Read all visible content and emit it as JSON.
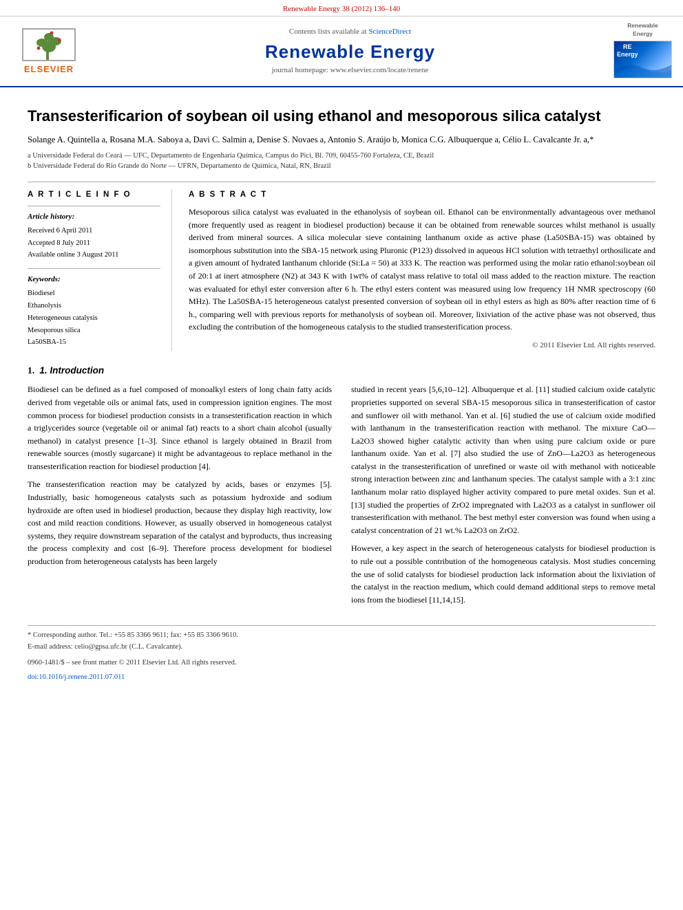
{
  "topbar": {
    "journal_ref": "Renewable Energy 38 (2012) 136–140"
  },
  "header": {
    "sciencedirect_text": "Contents lists available at",
    "sciencedirect_link": "ScienceDirect",
    "journal_name": "Renewable Energy",
    "homepage_text": "journal homepage: www.elsevier.com/locate/renene",
    "elsevier_label": "ELSEVIER",
    "re_label": "Renewable Energy"
  },
  "article": {
    "title": "Transesterificarion of soybean oil using ethanol and mesoporous silica catalyst",
    "authors": "Solange A. Quintella a, Rosana M.A. Saboya a, Davi C. Salmin a, Denise S. Novaes a, Antonio S. Araújo b, Monica C.G. Albuquerque a, Célio L. Cavalcante Jr. a,*",
    "affil_a": "a Universidade Federal do Ceará — UFC, Departamento de Engenharia Química, Campus do Pici, Bl. 709, 60455-760 Fortaleza, CE, Brazil",
    "affil_b": "b Universidade Federal do Rio Grande do Norte — UFRN, Departamento de Química, Natal, RN, Brazil",
    "article_info_label": "A R T I C L E   I N F O",
    "article_history_label": "Article history:",
    "received": "Received 6 April 2011",
    "accepted": "Accepted 8 July 2011",
    "available": "Available online 3 August 2011",
    "keywords_label": "Keywords:",
    "kw1": "Biodiesel",
    "kw2": "Ethanolysis",
    "kw3": "Heterogeneous catalysis",
    "kw4": "Mesoporous silica",
    "kw5": "La50SBA-15",
    "abstract_label": "A B S T R A C T",
    "abstract": "Mesoporous silica catalyst was evaluated in the ethanolysis of soybean oil. Ethanol can be environmentally advantageous over methanol (more frequently used as reagent in biodiesel production) because it can be obtained from renewable sources whilst methanol is usually derived from mineral sources. A silica molecular sieve containing lanthanum oxide as active phase (La50SBA-15) was obtained by isomorphous substitution into the SBA-15 network using Pluronic (P123) dissolved in aqueous HCl solution with tetraethyl orthosilicate and a given amount of hydrated lanthanum chloride (Si:La = 50) at 333 K. The reaction was performed using the molar ratio ethanol:soybean oil of 20:1 at inert atmosphere (N2) at 343 K with 1wt% of catalyst mass relative to total oil mass added to the reaction mixture. The reaction was evaluated for ethyl ester conversion after 6 h. The ethyl esters content was measured using low frequency 1H NMR spectroscopy (60 MHz). The La50SBA-15 heterogeneous catalyst presented conversion of soybean oil in ethyl esters as high as 80% after reaction time of 6 h., comparing well with previous reports for methanolysis of soybean oil. Moreover, lixiviation of the active phase was not observed, thus excluding the contribution of the homogeneous catalysis to the studied transesterification process.",
    "copyright": "© 2011 Elsevier Ltd. All rights reserved.",
    "intro_heading": "1.   Introduction",
    "intro_left_p1": "Biodiesel can be defined as a fuel composed of monoalkyl esters of long chain fatty acids derived from vegetable oils or animal fats, used in compression ignition engines. The most common process for biodiesel production consists in a transesterification reaction in which a triglycerides source (vegetable oil or animal fat) reacts to a short chain alcohol (usually methanol) in catalyst presence [1–3]. Since ethanol is largely obtained in Brazil from renewable sources (mostly sugarcane) it might be advantageous to replace methanol in the transesterification reaction for biodiesel production [4].",
    "intro_left_p2": "The transesterification reaction may be catalyzed by acids, bases or enzymes [5]. Industrially, basic homogeneous catalysts such as potassium hydroxide and sodium hydroxide are often used in biodiesel production, because they display high reactivity, low cost and mild reaction conditions. However, as usually observed in homogeneous catalyst systems, they require downstream separation of the catalyst and byproducts, thus increasing the process complexity and cost [6–9]. Therefore process development for biodiesel production from heterogeneous catalysts has been largely",
    "intro_right_p1": "studied in recent years [5,6,10–12]. Albuquerque et al. [11] studied calcium oxide catalytic proprieties supported on several SBA-15 mesoporous silica in transesterification of castor and sunflower oil with methanol. Yan et al. [6] studied the use of calcium oxide modified with lanthanum in the transesterification reaction with methanol. The mixture CaO—La2O3 showed higher catalytic activity than when using pure calcium oxide or pure lanthanum oxide. Yan et al. [7] also studied the use of ZnO—La2O3 as heterogeneous catalyst in the transesterification of unrefined or waste oil with methanol with noticeable strong interaction between zinc and lanthanum species. The catalyst sample with a 3:1 zinc lanthanum molar ratio displayed higher activity compared to pure metal oxides. Sun et al. [13] studied the properties of ZrO2 impregnated with La2O3 as a catalyst in sunflower oil transesterification with methanol. The best methyl ester conversion was found when using a catalyst concentration of 21 wt.% La2O3 on ZrO2.",
    "intro_right_p2": "However, a key aspect in the search of heterogeneous catalysts for biodiesel production is to rule out a possible contribution of the homogeneous catalysis. Most studies concerning the use of solid catalysts for biodiesel production lack information about the lixiviation of the catalyst in the reaction medium, which could demand additional steps to remove metal ions from the biodiesel [11,14,15].",
    "footnote_star": "* Corresponding author. Tel.: +55 85 3366 9611; fax: +55 85 3366 9610.",
    "footnote_email": "E-mail address: celio@gpsa.ufc.br (C.L. Cavalcante).",
    "issn_line": "0960-1481/$ – see front matter © 2011 Elsevier Ltd. All rights reserved.",
    "doi": "doi:10.1016/j.renene.2011.07.011"
  }
}
